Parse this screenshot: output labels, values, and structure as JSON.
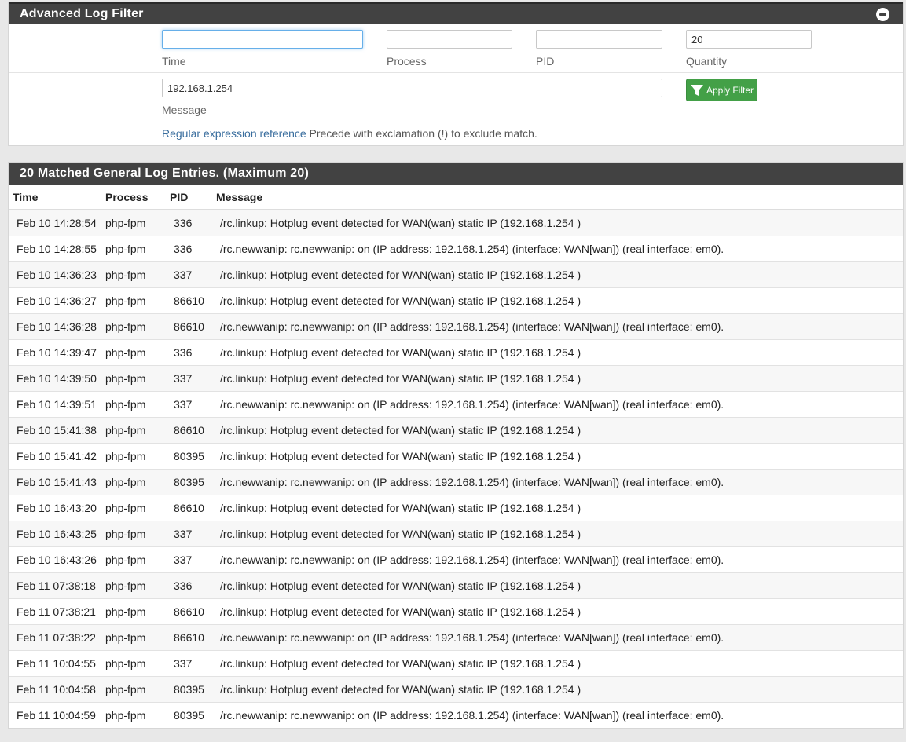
{
  "filter": {
    "title": "Advanced Log Filter",
    "time": {
      "label": "Time",
      "value": ""
    },
    "process": {
      "label": "Process",
      "value": ""
    },
    "pid": {
      "label": "PID",
      "value": ""
    },
    "quantity": {
      "label": "Quantity",
      "value": "20"
    },
    "message": {
      "label": "Message",
      "value": "192.168.1.254"
    },
    "apply_label": "Apply Filter",
    "regex_link": "Regular expression reference",
    "regex_hint": " Precede with exclamation (!) to exclude match."
  },
  "log": {
    "title": "20 Matched General Log Entries. (Maximum 20)",
    "columns": {
      "time": "Time",
      "process": "Process",
      "pid": "PID",
      "message": "Message"
    },
    "rows": [
      {
        "time": "Feb 10 14:28:54",
        "process": "php-fpm",
        "pid": "336",
        "message": "/rc.linkup: Hotplug event detected for WAN(wan) static IP (192.168.1.254 )"
      },
      {
        "time": "Feb 10 14:28:55",
        "process": "php-fpm",
        "pid": "336",
        "message": "/rc.newwanip: rc.newwanip: on (IP address: 192.168.1.254) (interface: WAN[wan]) (real interface: em0)."
      },
      {
        "time": "Feb 10 14:36:23",
        "process": "php-fpm",
        "pid": "337",
        "message": "/rc.linkup: Hotplug event detected for WAN(wan) static IP (192.168.1.254 )"
      },
      {
        "time": "Feb 10 14:36:27",
        "process": "php-fpm",
        "pid": "86610",
        "message": "/rc.linkup: Hotplug event detected for WAN(wan) static IP (192.168.1.254 )"
      },
      {
        "time": "Feb 10 14:36:28",
        "process": "php-fpm",
        "pid": "86610",
        "message": "/rc.newwanip: rc.newwanip: on (IP address: 192.168.1.254) (interface: WAN[wan]) (real interface: em0)."
      },
      {
        "time": "Feb 10 14:39:47",
        "process": "php-fpm",
        "pid": "336",
        "message": "/rc.linkup: Hotplug event detected for WAN(wan) static IP (192.168.1.254 )"
      },
      {
        "time": "Feb 10 14:39:50",
        "process": "php-fpm",
        "pid": "337",
        "message": "/rc.linkup: Hotplug event detected for WAN(wan) static IP (192.168.1.254 )"
      },
      {
        "time": "Feb 10 14:39:51",
        "process": "php-fpm",
        "pid": "337",
        "message": "/rc.newwanip: rc.newwanip: on (IP address: 192.168.1.254) (interface: WAN[wan]) (real interface: em0)."
      },
      {
        "time": "Feb 10 15:41:38",
        "process": "php-fpm",
        "pid": "86610",
        "message": "/rc.linkup: Hotplug event detected for WAN(wan) static IP (192.168.1.254 )"
      },
      {
        "time": "Feb 10 15:41:42",
        "process": "php-fpm",
        "pid": "80395",
        "message": "/rc.linkup: Hotplug event detected for WAN(wan) static IP (192.168.1.254 )"
      },
      {
        "time": "Feb 10 15:41:43",
        "process": "php-fpm",
        "pid": "80395",
        "message": "/rc.newwanip: rc.newwanip: on (IP address: 192.168.1.254) (interface: WAN[wan]) (real interface: em0)."
      },
      {
        "time": "Feb 10 16:43:20",
        "process": "php-fpm",
        "pid": "86610",
        "message": "/rc.linkup: Hotplug event detected for WAN(wan) static IP (192.168.1.254 )"
      },
      {
        "time": "Feb 10 16:43:25",
        "process": "php-fpm",
        "pid": "337",
        "message": "/rc.linkup: Hotplug event detected for WAN(wan) static IP (192.168.1.254 )"
      },
      {
        "time": "Feb 10 16:43:26",
        "process": "php-fpm",
        "pid": "337",
        "message": "/rc.newwanip: rc.newwanip: on (IP address: 192.168.1.254) (interface: WAN[wan]) (real interface: em0)."
      },
      {
        "time": "Feb 11 07:38:18",
        "process": "php-fpm",
        "pid": "336",
        "message": "/rc.linkup: Hotplug event detected for WAN(wan) static IP (192.168.1.254 )"
      },
      {
        "time": "Feb 11 07:38:21",
        "process": "php-fpm",
        "pid": "86610",
        "message": "/rc.linkup: Hotplug event detected for WAN(wan) static IP (192.168.1.254 )"
      },
      {
        "time": "Feb 11 07:38:22",
        "process": "php-fpm",
        "pid": "86610",
        "message": "/rc.newwanip: rc.newwanip: on (IP address: 192.168.1.254) (interface: WAN[wan]) (real interface: em0)."
      },
      {
        "time": "Feb 11 10:04:55",
        "process": "php-fpm",
        "pid": "337",
        "message": "/rc.linkup: Hotplug event detected for WAN(wan) static IP (192.168.1.254 )"
      },
      {
        "time": "Feb 11 10:04:58",
        "process": "php-fpm",
        "pid": "80395",
        "message": "/rc.linkup: Hotplug event detected for WAN(wan) static IP (192.168.1.254 )"
      },
      {
        "time": "Feb 11 10:04:59",
        "process": "php-fpm",
        "pid": "80395",
        "message": "/rc.newwanip: rc.newwanip: on (IP address: 192.168.1.254) (interface: WAN[wan]) (real interface: em0)."
      }
    ]
  },
  "colors": {
    "heading_bg": "#424242",
    "apply_button": "#43a047",
    "link": "#3a6e9e"
  }
}
